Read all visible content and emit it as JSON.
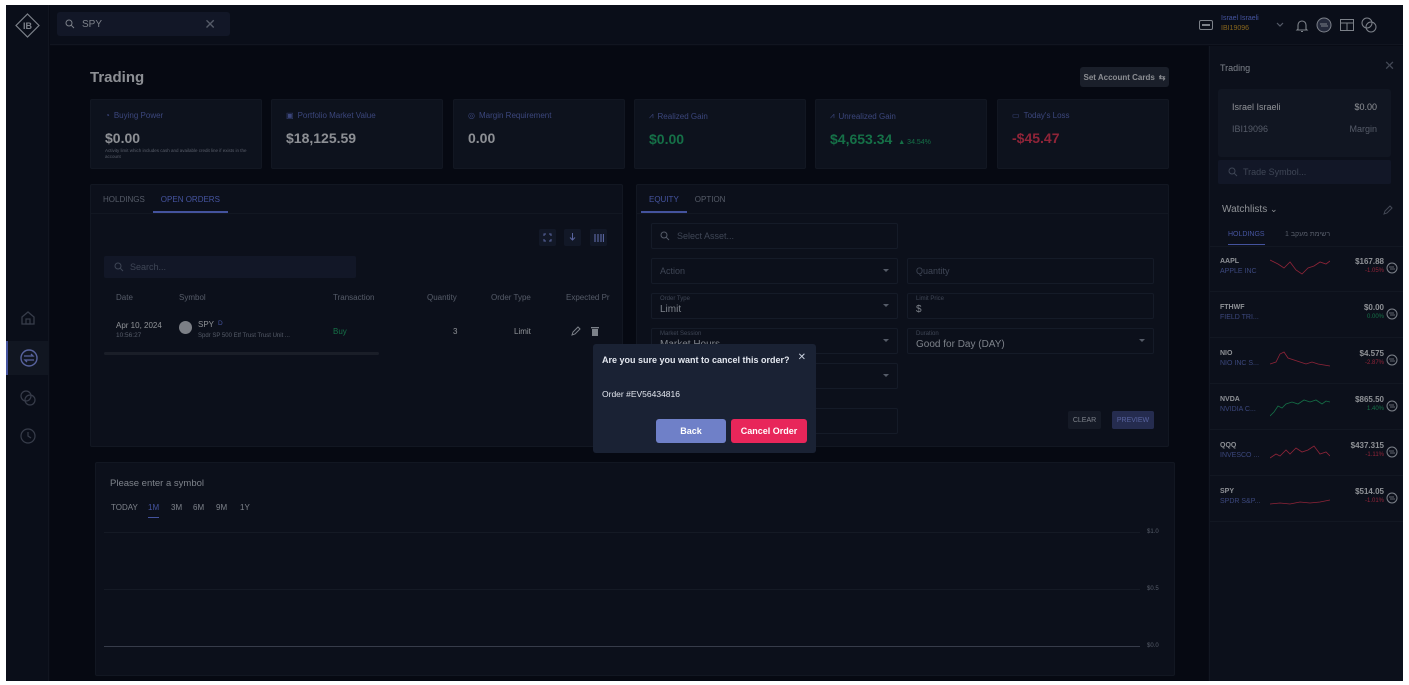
{
  "topbar": {
    "search_value": "SPY",
    "user_name": "Israel Israeli",
    "account_id": "IBI19096"
  },
  "main": {
    "title": "Trading",
    "set_cards_label": "Set Account Cards",
    "cards": [
      {
        "label": "Buying Power",
        "value": "$0.00",
        "sub": "Activity limit which includes cash and available credit line if exists in the account",
        "icon": "hand-coin-icon"
      },
      {
        "label": "Portfolio Market Value",
        "value": "$18,125.59",
        "icon": "portfolio-icon"
      },
      {
        "label": "Margin Requirement",
        "value": "0.00",
        "icon": "margin-icon"
      },
      {
        "label": "Realized Gain",
        "value": "$0.00",
        "icon": "gain-icon"
      },
      {
        "label": "Unrealized Gain",
        "value": "$4,653.34",
        "change": "▲ 34.54%",
        "icon": "gain-icon"
      },
      {
        "label": "Today's Loss",
        "value": "-$45.47",
        "icon": "calendar-icon"
      }
    ]
  },
  "orders": {
    "tabs": [
      "HOLDINGS",
      "OPEN ORDERS"
    ],
    "search_placeholder": "Search...",
    "headers": [
      "Date",
      "Symbol",
      "Transaction",
      "Quantity",
      "Order Type",
      "Expected Pr"
    ],
    "row": {
      "date": "Apr 10, 2024",
      "time": "10:56:27",
      "symbol": "SPY",
      "symbol_tag": "D",
      "name": "Spdr SP 500 Etf Trust Trust Unit ...",
      "transaction": "Buy",
      "quantity": "3",
      "order_type": "Limit"
    }
  },
  "ticket": {
    "tabs": [
      "EQUITY",
      "OPTION"
    ],
    "asset_placeholder": "Select Asset...",
    "action_placeholder": "Action",
    "quantity_placeholder": "Quantity",
    "order_type_label": "Order Type",
    "order_type_value": "Limit",
    "limit_price_label": "Limit Price",
    "limit_price_value": "$",
    "session_label": "Market Session",
    "session_value": "Market Hours",
    "duration_label": "Duration",
    "duration_value": "Good for Day (DAY)",
    "clear_label": "CLEAR",
    "preview_label": "PREVIEW"
  },
  "chart": {
    "prompt": "Please enter a symbol",
    "ranges": [
      "TODAY",
      "1M",
      "3M",
      "6M",
      "9M",
      "1Y"
    ],
    "active_range": "1M",
    "y_labels": [
      "$1.0",
      "$0.5",
      "$0.0"
    ]
  },
  "right_panel": {
    "title": "Trading",
    "account_name": "Israel Israeli",
    "account_value": "$0.00",
    "account_id": "IBI19096",
    "account_type": "Margin",
    "trade_placeholder": "Trade Symbol...",
    "watchlists_label": "Watchlists",
    "watch_tabs": [
      "HOLDINGS",
      "רשימת מעקב 1"
    ],
    "watchlist": [
      {
        "symbol": "AAPL",
        "name": "APPLE INC",
        "price": "$167.88",
        "change": "-1.05%",
        "color": "#e83a5b"
      },
      {
        "symbol": "FTHWF",
        "name": "FIELD TRI...",
        "price": "$0.00",
        "change": "0.00%",
        "color": "#22b573"
      },
      {
        "symbol": "NIO",
        "name": "NIO INC S...",
        "price": "$4.575",
        "change": "-2.87%",
        "color": "#e83a5b"
      },
      {
        "symbol": "NVDA",
        "name": "NVIDIA C...",
        "price": "$865.50",
        "change": "1.40%",
        "color": "#22b573"
      },
      {
        "symbol": "QQQ",
        "name": "INVESCO ...",
        "price": "$437.315",
        "change": "-1.11%",
        "color": "#e83a5b"
      },
      {
        "symbol": "SPY",
        "name": "SPDR S&P...",
        "price": "$514.05",
        "change": "-1.01%",
        "color": "#e83a5b"
      }
    ]
  },
  "modal": {
    "title": "Are you sure you want to cancel this order?",
    "order_text": "Order #EV56434816",
    "back_label": "Back",
    "cancel_label": "Cancel Order"
  }
}
